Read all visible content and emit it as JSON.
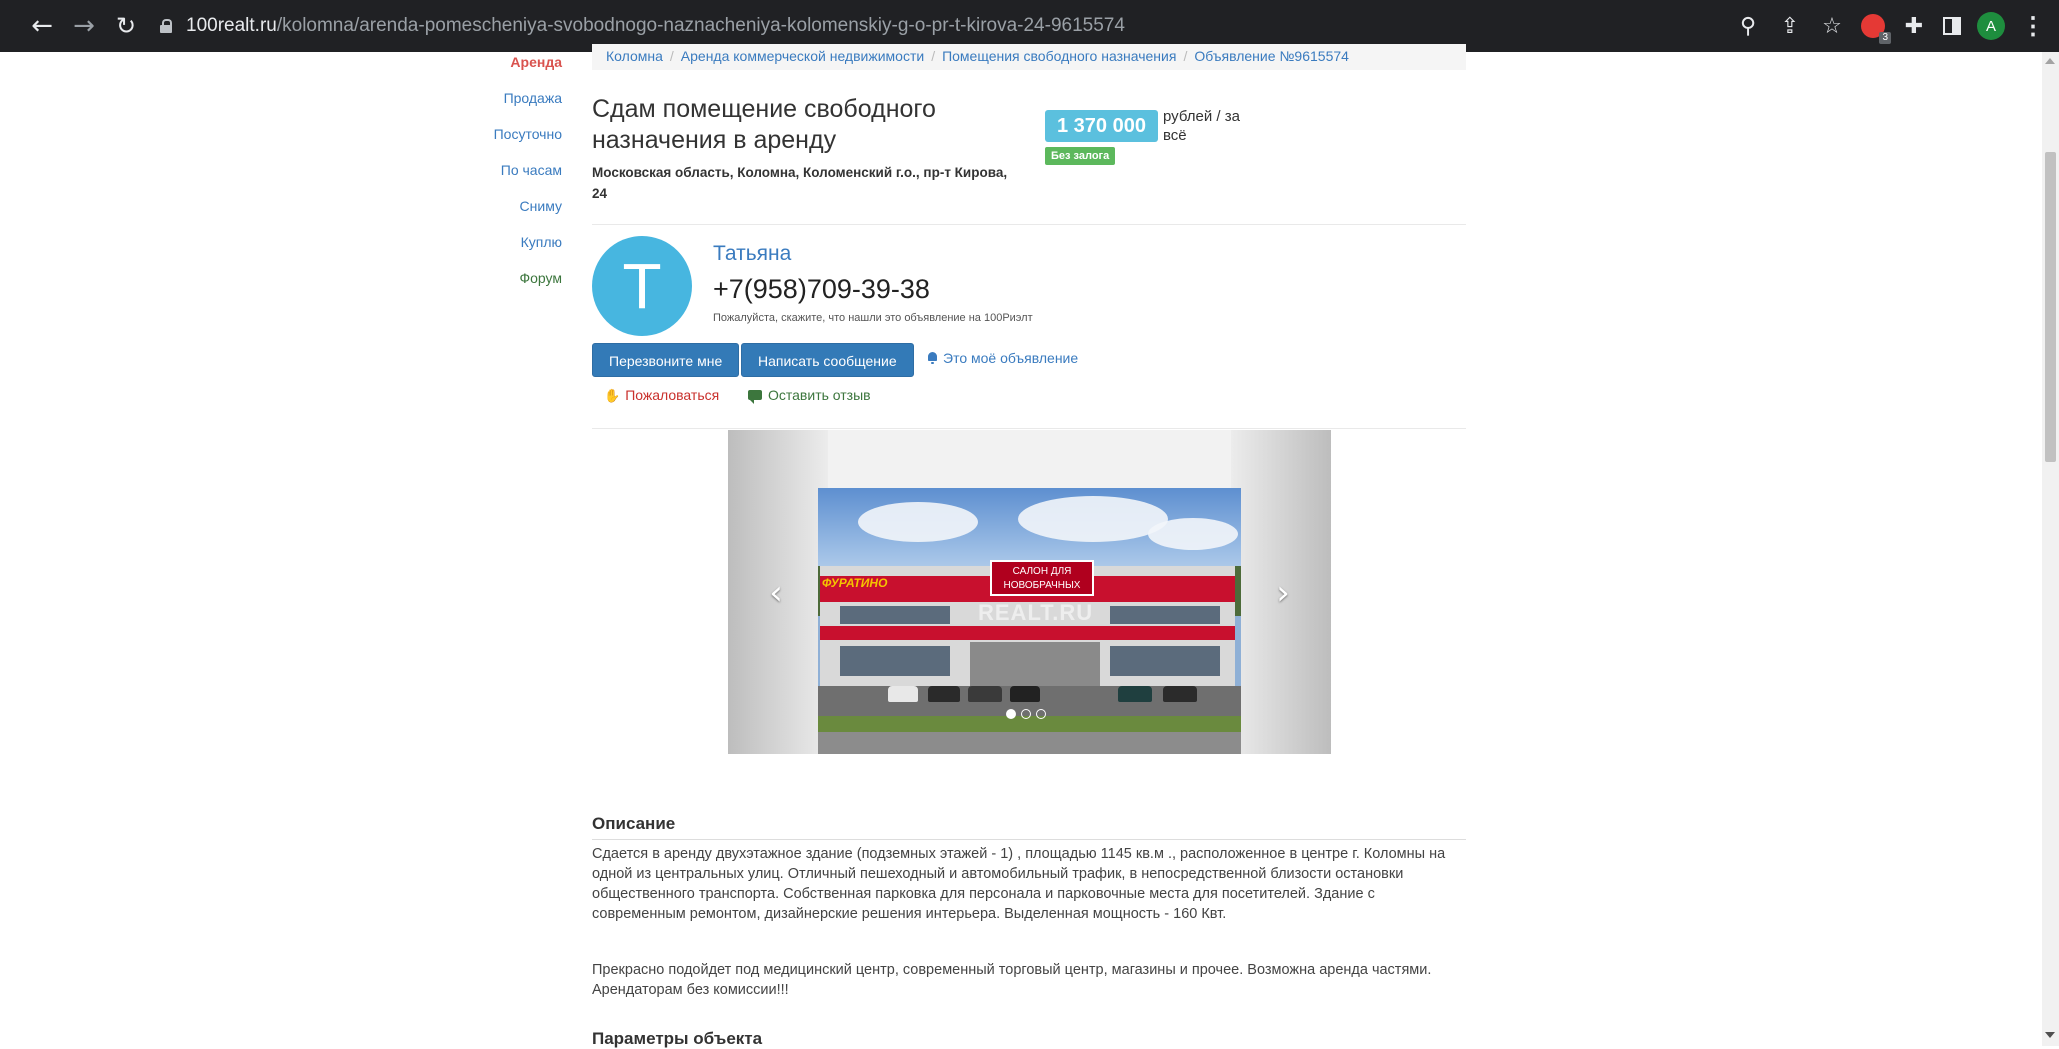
{
  "browser": {
    "url_host": "100realt.ru",
    "url_path": "/kolomna/arenda-pomescheniya-svobodnogo-naznacheniya-kolomenskiy-g-o-pr-t-kirova-24-9615574",
    "extension_badge": "3",
    "profile_letter": "A"
  },
  "menu": {
    "items": [
      {
        "label": "Аренда",
        "active": true
      },
      {
        "label": "Продажа"
      },
      {
        "label": "Посуточно"
      },
      {
        "label": "По часам"
      },
      {
        "label": "Сниму"
      },
      {
        "label": "Куплю"
      },
      {
        "label": "Форум"
      }
    ]
  },
  "breadcrumb": [
    "Коломна",
    "Аренда коммерческой недвижимости",
    "Помещения свободного назначения",
    "Объявление №9615574"
  ],
  "listing": {
    "title": "Сдам помещение свободного назначения в аренду",
    "address": "Московская область, Коломна, Коломенский г.о., пр-т Кирова, 24",
    "price": "1 370 000",
    "price_unit": "рублей / за всё",
    "deposit_badge": "Без залога"
  },
  "agent": {
    "initial": "Т",
    "name": "Татьяна",
    "phone": "+7(958)709-39-38",
    "note": "Пожалуйста, скажите, что нашли это объявление на 100Риэлт"
  },
  "actions": {
    "call_back": "Перезвоните мне",
    "write_message": "Написать сообщение",
    "my_listing": "Это моё объявление",
    "complain": "Пожаловаться",
    "review": "Оставить отзыв"
  },
  "gallery": {
    "watermark": "REALT.RU",
    "sign_text": "САЛОН ДЛЯ НОВОБРАЧНЫХ",
    "store_text": "ФУРАТИНО",
    "slides_total": 3,
    "active_slide": 1
  },
  "description": {
    "heading": "Описание",
    "paragraph1": "Сдается в аренду двухэтажное здание  (подземных этажей  - 1) , площадью 1145 кв.м ., расположенное в центре г. Коломны на одной из центральных улиц. Отличный пешеходный и автомобильный трафик, в непосредственной близости остановки общественного транспорта. Собственная парковка для персонала и парковочные места для посетителей. Здание с современным ремонтом, дизайнерские решения интерьера. Выделенная мощность - 160 Квт.",
    "paragraph2": "Прекрасно подойдет под медицинский центр, современный торговый центр, магазины и прочее. Возможна аренда частями.  Арендаторам без комиссии!!!",
    "params_heading": "Параметры объекта"
  },
  "colors": {
    "link": "#3a7bbf",
    "primary_button": "#337ab7",
    "price_badge": "#5bc0de",
    "deposit_badge": "#5cb85c",
    "avatar": "#47b6e0",
    "active_menu": "#d9534f"
  }
}
